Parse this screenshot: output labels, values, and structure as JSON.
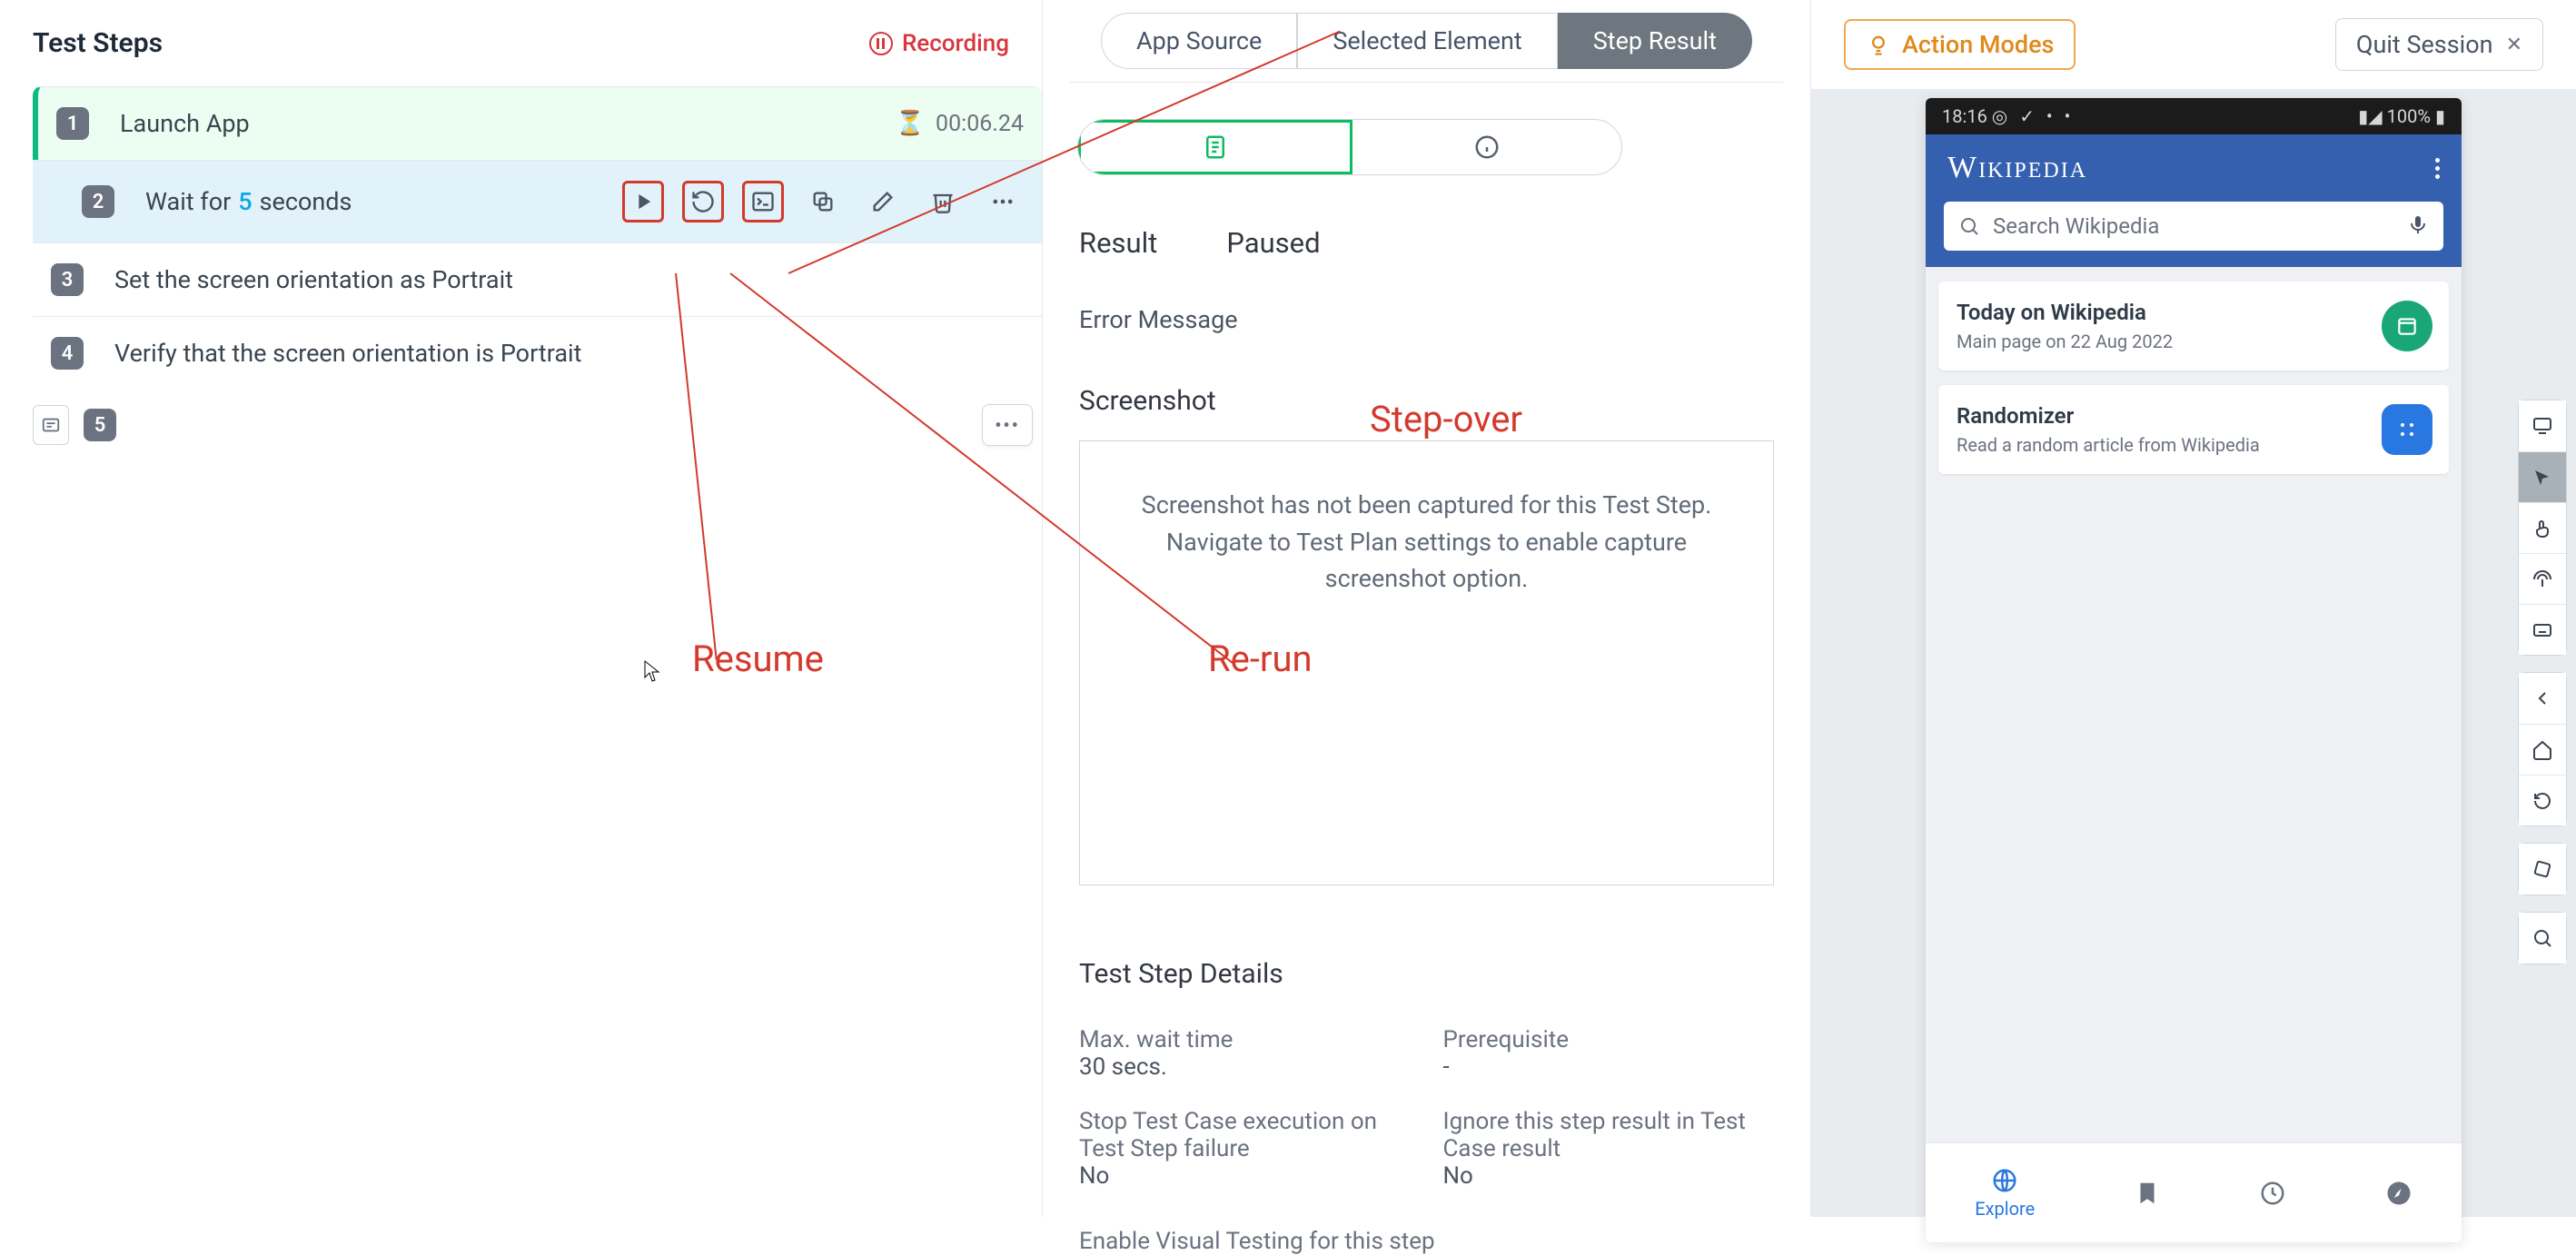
{
  "header": {
    "title": "Test Steps",
    "recording_label": "Recording"
  },
  "steps": [
    {
      "num": "1",
      "text": "Launch App",
      "timer": "00:06.24"
    },
    {
      "num": "2",
      "text_pre": "Wait for",
      "param": "5",
      "text_post": "seconds"
    },
    {
      "num": "3",
      "text": "Set the screen orientation as Portrait"
    },
    {
      "num": "4",
      "text": "Verify that the screen orientation is Portrait"
    }
  ],
  "extra_step_num": "5",
  "tabs": {
    "app_source": "App Source",
    "selected_element": "Selected Element",
    "step_result": "Step Result"
  },
  "result_section": {
    "result_label": "Result",
    "paused_label": "Paused",
    "error_label": "Error Message",
    "screenshot_label": "Screenshot",
    "screenshot_msg1": "Screenshot has not been captured for this Test Step.",
    "screenshot_msg2": "Navigate to Test Plan settings to enable capture screenshot option."
  },
  "details": {
    "heading": "Test Step Details",
    "max_wait_lbl": "Max. wait time",
    "max_wait_val": "30 secs.",
    "prereq_lbl": "Prerequisite",
    "prereq_val": "-",
    "stop_lbl": "Stop Test Case execution on Test Step failure",
    "stop_val": "No",
    "ignore_lbl": "Ignore this step result in Test Case result",
    "ignore_val": "No",
    "visual_lbl": "Enable Visual Testing for this step"
  },
  "right": {
    "action_modes": "Action Modes",
    "quit": "Quit Session"
  },
  "device": {
    "time": "18:16",
    "stat_icons": "◎ ✓ • •",
    "battery": "100%",
    "wiki_brand": "WIKIPEDIA",
    "search_placeholder": "Search Wikipedia",
    "card1_title": "Today on Wikipedia",
    "card1_sub": "Main page on 22 Aug 2022",
    "card2_title": "Randomizer",
    "card2_sub": "Read a random article from Wikipedia",
    "nav_explore": "Explore"
  },
  "annotations": {
    "stepover": "Step-over",
    "resume": "Resume",
    "rerun": "Re-run"
  },
  "signal_icon": "▮◢"
}
